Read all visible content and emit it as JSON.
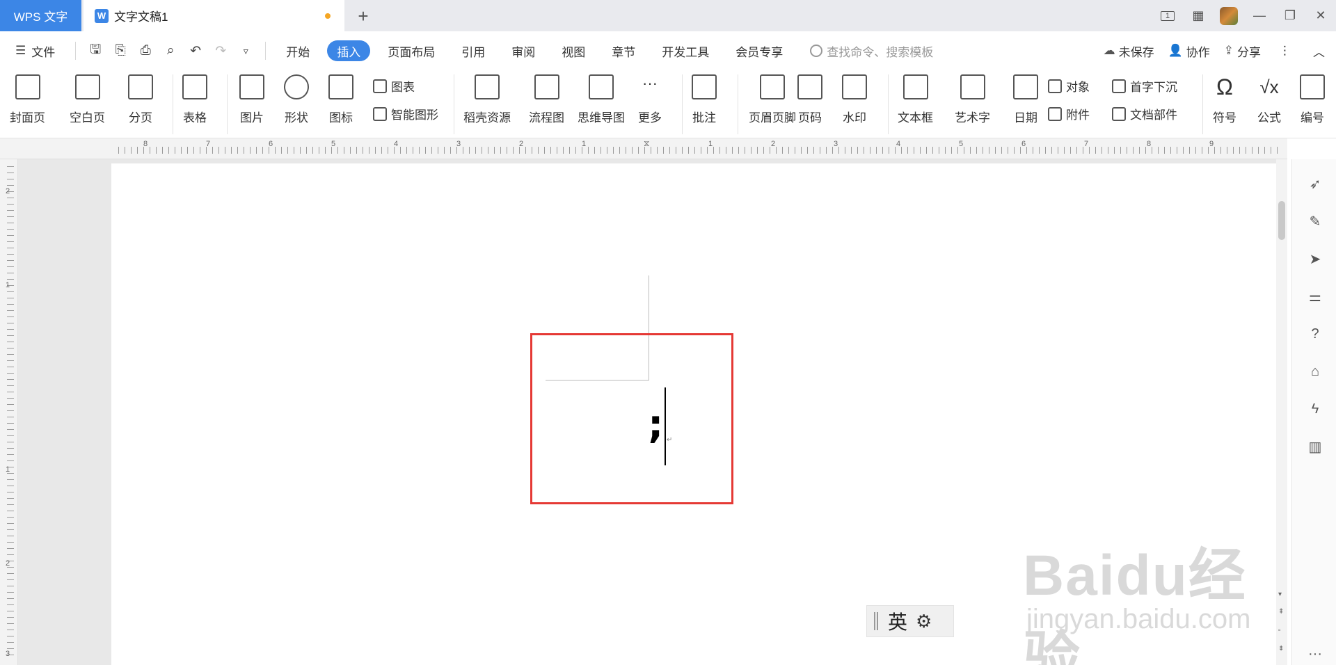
{
  "titlebar": {
    "app_name": "WPS 文字",
    "doc_title": "文字文稿1",
    "new_tab": "+",
    "page_view_label": "1"
  },
  "menubar": {
    "file": "文件",
    "tabs": [
      "开始",
      "插入",
      "页面布局",
      "引用",
      "审阅",
      "视图",
      "章节",
      "开发工具",
      "会员专享"
    ],
    "active_tab": "插入",
    "search_placeholder": "查找命令、搜索模板",
    "unsaved": "未保存",
    "collaborate": "协作",
    "share": "分享"
  },
  "ribbon": {
    "cover": "封面页",
    "blank": "空白页",
    "pagebreak": "分页",
    "table": "表格",
    "picture": "图片",
    "shape": "形状",
    "icon": "图标",
    "chart": "图表",
    "smartart": "智能图形",
    "resources": "稻壳资源",
    "flowchart": "流程图",
    "mindmap": "思维导图",
    "more": "更多",
    "comment": "批注",
    "header_footer": "页眉页脚",
    "page_number": "页码",
    "watermark": "水印",
    "textbox": "文本框",
    "wordart": "艺术字",
    "date": "日期",
    "object": "对象",
    "attachment": "附件",
    "dropcap": "首字下沉",
    "docparts": "文档部件",
    "symbol": "符号",
    "formula": "公式",
    "edit": "编号"
  },
  "ruler": {
    "left_numbers": [
      "8",
      "7",
      "6",
      "5",
      "4",
      "3",
      "2",
      "1"
    ],
    "right_numbers": [
      "1",
      "2",
      "3",
      "4",
      "5",
      "6",
      "7",
      "8",
      "9"
    ],
    "vertical_numbers": [
      "2",
      "1",
      "1",
      "2",
      "3"
    ]
  },
  "document": {
    "typed_char": ";",
    "paragraph_mark": "↵"
  },
  "ime": {
    "mode": "英",
    "gear": "⚙"
  },
  "watermark": {
    "main": "Baidu经验",
    "sub": "jingyan.baidu.com"
  },
  "colors": {
    "accent": "#3c86e6",
    "highlight_border": "#e53935",
    "unsaved_dot": "#f5a623"
  }
}
